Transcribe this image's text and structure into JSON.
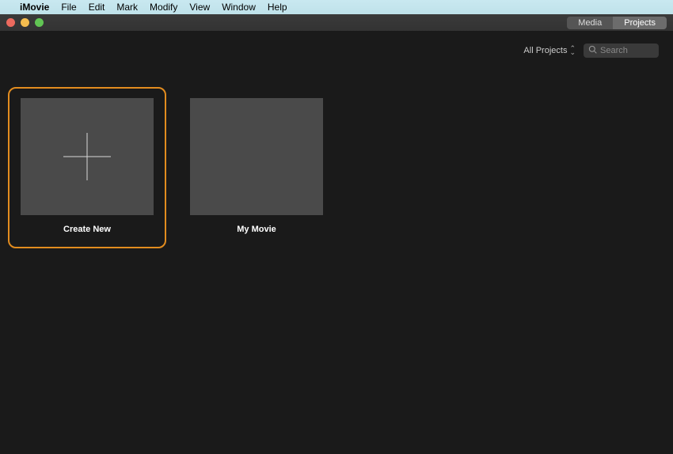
{
  "menubar": {
    "app_name": "iMovie",
    "items": [
      "File",
      "Edit",
      "Mark",
      "Modify",
      "View",
      "Window",
      "Help"
    ]
  },
  "nav": {
    "media": "Media",
    "projects": "Projects"
  },
  "filter": {
    "dropdown": "All Projects",
    "search_placeholder": "Search"
  },
  "cards": {
    "create_new": "Create New",
    "my_movie": "My Movie"
  }
}
